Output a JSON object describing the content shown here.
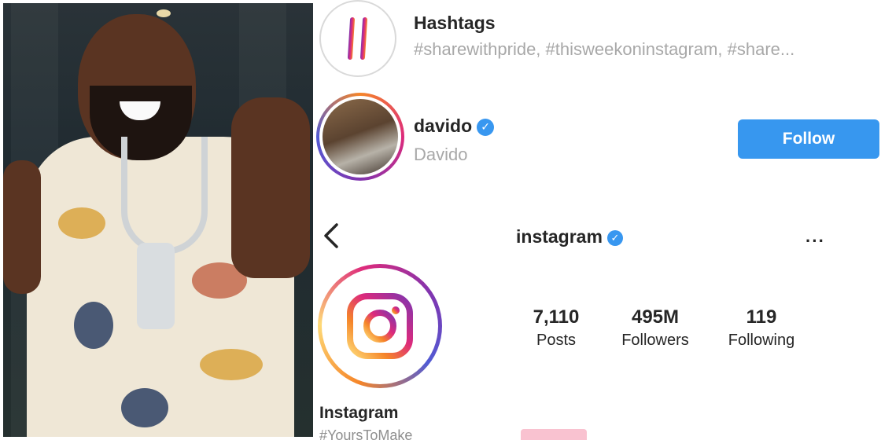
{
  "hashtags": {
    "title": "Hashtags",
    "subtitle": "#sharewithpride, #thisweekoninstagram, #share...",
    "icon": "hashtag-icon"
  },
  "account": {
    "username": "davido",
    "full_name": "Davido",
    "verified": true,
    "follow_label": "Follow"
  },
  "profile": {
    "username": "instagram",
    "verified": true,
    "more_label": "···",
    "display_name": "Instagram",
    "bio_partial": "#YoursToMake",
    "stats": [
      {
        "value": "7,110",
        "label": "Posts"
      },
      {
        "value": "495M",
        "label": "Followers"
      },
      {
        "value": "119",
        "label": "Following"
      }
    ]
  },
  "colors": {
    "follow_button": "#3797ef",
    "verified_badge": "#3897f0",
    "muted_text": "#a8a8a8"
  }
}
